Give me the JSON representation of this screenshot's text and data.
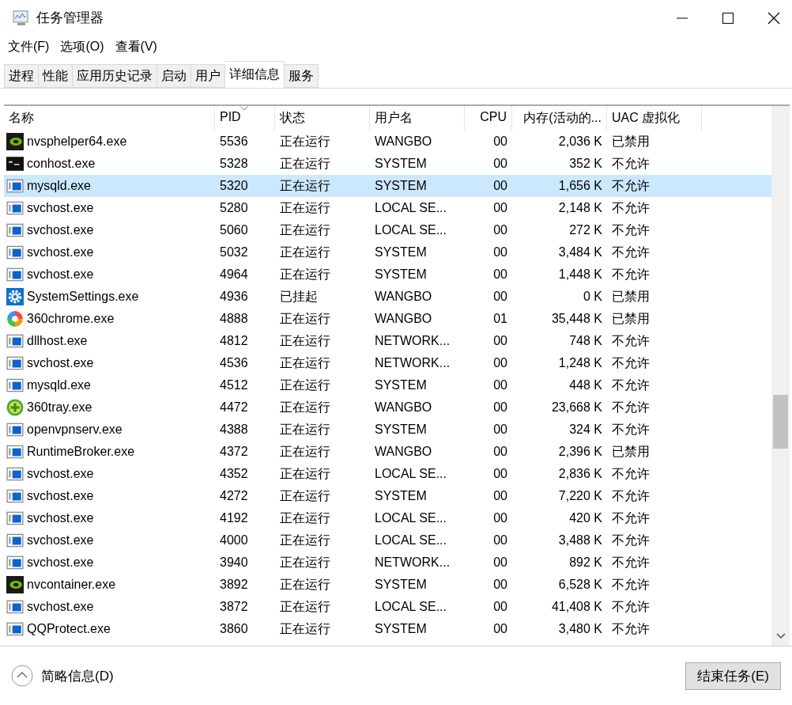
{
  "window": {
    "title": "任务管理器"
  },
  "menu": [
    "文件(F)",
    "选项(O)",
    "查看(V)"
  ],
  "tabs": [
    {
      "label": "进程",
      "selected": false
    },
    {
      "label": "性能",
      "selected": false
    },
    {
      "label": "应用历史记录",
      "selected": false
    },
    {
      "label": "启动",
      "selected": false
    },
    {
      "label": "用户",
      "selected": false
    },
    {
      "label": "详细信息",
      "selected": true
    },
    {
      "label": "服务",
      "selected": false
    }
  ],
  "table": {
    "columns": [
      "名称",
      "PID",
      "状态",
      "用户名",
      "CPU",
      "内存(活动的...",
      "UAC 虚拟化"
    ],
    "rows": [
      {
        "kind": "gpu",
        "name": "nvsphelper64.exe",
        "pid": "5536",
        "status": "正在运行",
        "user": "WANGBO",
        "cpu": "00",
        "memory": "2,036 K",
        "uac": "已禁用",
        "selected": false
      },
      {
        "kind": "console",
        "name": "conhost.exe",
        "pid": "5328",
        "status": "正在运行",
        "user": "SYSTEM",
        "cpu": "00",
        "memory": "352 K",
        "uac": "不允许",
        "selected": false
      },
      {
        "kind": "window",
        "name": "mysqld.exe",
        "pid": "5320",
        "status": "正在运行",
        "user": "SYSTEM",
        "cpu": "00",
        "memory": "1,656 K",
        "uac": "不允许",
        "selected": true
      },
      {
        "kind": "window",
        "name": "svchost.exe",
        "pid": "5280",
        "status": "正在运行",
        "user": "LOCAL SE...",
        "cpu": "00",
        "memory": "2,148 K",
        "uac": "不允许",
        "selected": false
      },
      {
        "kind": "window",
        "name": "svchost.exe",
        "pid": "5060",
        "status": "正在运行",
        "user": "LOCAL SE...",
        "cpu": "00",
        "memory": "272 K",
        "uac": "不允许",
        "selected": false
      },
      {
        "kind": "window",
        "name": "svchost.exe",
        "pid": "5032",
        "status": "正在运行",
        "user": "SYSTEM",
        "cpu": "00",
        "memory": "3,484 K",
        "uac": "不允许",
        "selected": false
      },
      {
        "kind": "window",
        "name": "svchost.exe",
        "pid": "4964",
        "status": "正在运行",
        "user": "SYSTEM",
        "cpu": "00",
        "memory": "1,448 K",
        "uac": "不允许",
        "selected": false
      },
      {
        "kind": "gear",
        "name": "SystemSettings.exe",
        "pid": "4936",
        "status": "已挂起",
        "user": "WANGBO",
        "cpu": "00",
        "memory": "0 K",
        "uac": "已禁用",
        "selected": false
      },
      {
        "kind": "browser",
        "name": "360chrome.exe",
        "pid": "4888",
        "status": "正在运行",
        "user": "WANGBO",
        "cpu": "01",
        "memory": "35,448 K",
        "uac": "已禁用",
        "selected": false
      },
      {
        "kind": "window",
        "name": "dllhost.exe",
        "pid": "4812",
        "status": "正在运行",
        "user": "NETWORK...",
        "cpu": "00",
        "memory": "748 K",
        "uac": "不允许",
        "selected": false
      },
      {
        "kind": "window",
        "name": "svchost.exe",
        "pid": "4536",
        "status": "正在运行",
        "user": "NETWORK...",
        "cpu": "00",
        "memory": "1,248 K",
        "uac": "不允许",
        "selected": false
      },
      {
        "kind": "window",
        "name": "mysqld.exe",
        "pid": "4512",
        "status": "正在运行",
        "user": "SYSTEM",
        "cpu": "00",
        "memory": "448 K",
        "uac": "不允许",
        "selected": false
      },
      {
        "kind": "plus",
        "name": "360tray.exe",
        "pid": "4472",
        "status": "正在运行",
        "user": "WANGBO",
        "cpu": "00",
        "memory": "23,668 K",
        "uac": "不允许",
        "selected": false
      },
      {
        "kind": "window",
        "name": "openvpnserv.exe",
        "pid": "4388",
        "status": "正在运行",
        "user": "SYSTEM",
        "cpu": "00",
        "memory": "324 K",
        "uac": "不允许",
        "selected": false
      },
      {
        "kind": "window",
        "name": "RuntimeBroker.exe",
        "pid": "4372",
        "status": "正在运行",
        "user": "WANGBO",
        "cpu": "00",
        "memory": "2,396 K",
        "uac": "已禁用",
        "selected": false
      },
      {
        "kind": "window",
        "name": "svchost.exe",
        "pid": "4352",
        "status": "正在运行",
        "user": "LOCAL SE...",
        "cpu": "00",
        "memory": "2,836 K",
        "uac": "不允许",
        "selected": false
      },
      {
        "kind": "window",
        "name": "svchost.exe",
        "pid": "4272",
        "status": "正在运行",
        "user": "SYSTEM",
        "cpu": "00",
        "memory": "7,220 K",
        "uac": "不允许",
        "selected": false
      },
      {
        "kind": "window",
        "name": "svchost.exe",
        "pid": "4192",
        "status": "正在运行",
        "user": "LOCAL SE...",
        "cpu": "00",
        "memory": "420 K",
        "uac": "不允许",
        "selected": false
      },
      {
        "kind": "window",
        "name": "svchost.exe",
        "pid": "4000",
        "status": "正在运行",
        "user": "LOCAL SE...",
        "cpu": "00",
        "memory": "3,488 K",
        "uac": "不允许",
        "selected": false
      },
      {
        "kind": "window",
        "name": "svchost.exe",
        "pid": "3940",
        "status": "正在运行",
        "user": "NETWORK...",
        "cpu": "00",
        "memory": "892 K",
        "uac": "不允许",
        "selected": false
      },
      {
        "kind": "gpu",
        "name": "nvcontainer.exe",
        "pid": "3892",
        "status": "正在运行",
        "user": "SYSTEM",
        "cpu": "00",
        "memory": "6,528 K",
        "uac": "不允许",
        "selected": false
      },
      {
        "kind": "window",
        "name": "svchost.exe",
        "pid": "3872",
        "status": "正在运行",
        "user": "LOCAL SE...",
        "cpu": "00",
        "memory": "41,408 K",
        "uac": "不允许",
        "selected": false
      },
      {
        "kind": "window",
        "name": "QQProtect.exe",
        "pid": "3860",
        "status": "正在运行",
        "user": "SYSTEM",
        "cpu": "00",
        "memory": "3,480 K",
        "uac": "不允许",
        "selected": false
      }
    ]
  },
  "footer": {
    "details_toggle": "简略信息(D)",
    "end_task": "结束任务(E)"
  }
}
